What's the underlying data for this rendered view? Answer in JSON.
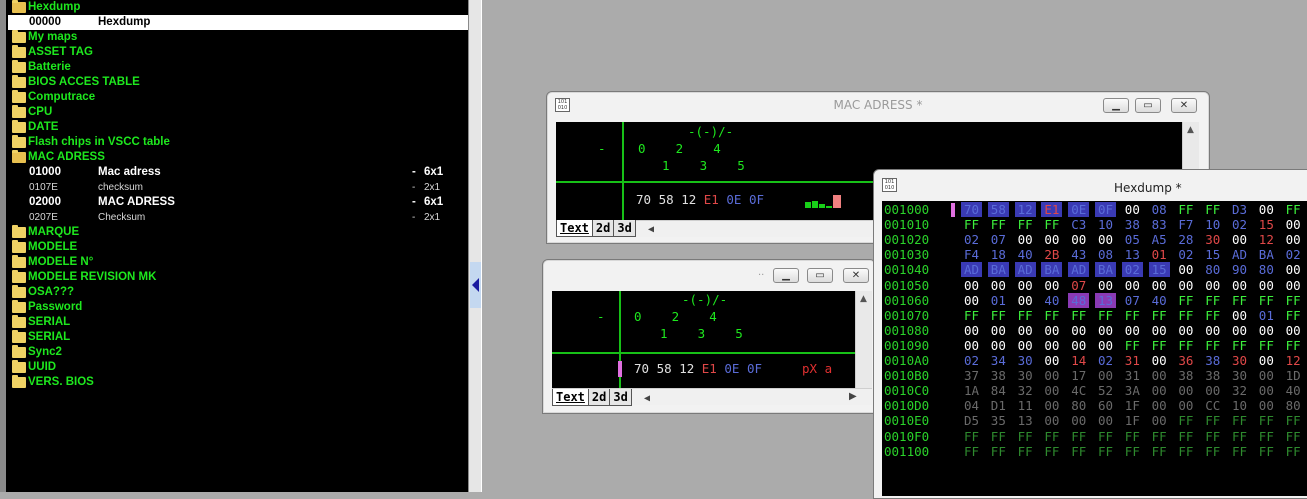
{
  "tree": {
    "items": [
      {
        "kind": "folder",
        "open": true,
        "label": "Hexdump"
      },
      {
        "kind": "leaf",
        "style": "sel",
        "id": "00000",
        "name": "Hexdump"
      },
      {
        "kind": "folder",
        "label": "My maps"
      },
      {
        "kind": "folder",
        "label": "ASSET TAG"
      },
      {
        "kind": "folder",
        "label": "Batterie"
      },
      {
        "kind": "folder",
        "label": "BIOS ACCES TABLE"
      },
      {
        "kind": "folder",
        "label": "Computrace"
      },
      {
        "kind": "folder",
        "label": "CPU"
      },
      {
        "kind": "folder",
        "label": "DATE"
      },
      {
        "kind": "folder",
        "label": "Flash chips in VSCC table"
      },
      {
        "kind": "folder",
        "open": true,
        "label": "MAC ADRESS"
      },
      {
        "kind": "leaf",
        "style": "bold",
        "id": "01000",
        "name": "Mac adress",
        "dash": "-",
        "size": "6x1"
      },
      {
        "kind": "leaf",
        "style": "dim",
        "id": "0107E",
        "name": "checksum",
        "dash": "-",
        "size": "2x1"
      },
      {
        "kind": "leaf",
        "style": "bold",
        "id": "02000",
        "name": "MAC ADRESS",
        "dash": "-",
        "size": "6x1"
      },
      {
        "kind": "leaf",
        "style": "dim",
        "id": "0207E",
        "name": "Checksum",
        "dash": "-",
        "size": "2x1"
      },
      {
        "kind": "folder",
        "label": "MARQUE"
      },
      {
        "kind": "folder",
        "label": "MODELE"
      },
      {
        "kind": "folder",
        "label": "MODELE N°"
      },
      {
        "kind": "folder",
        "label": "MODELE REVISION MK"
      },
      {
        "kind": "folder",
        "label": "OSA???"
      },
      {
        "kind": "folder",
        "label": "Password"
      },
      {
        "kind": "folder",
        "label": "SERIAL"
      },
      {
        "kind": "folder",
        "label": "SERIAL"
      },
      {
        "kind": "folder",
        "label": "Sync2"
      },
      {
        "kind": "folder",
        "label": "UUID"
      },
      {
        "kind": "folder",
        "label": "VERS. BIOS"
      }
    ]
  },
  "mac_window": {
    "title": "MAC ADRESS *",
    "header_line": "-(-)/-",
    "row_marker": "-",
    "top_index": "0    2    4",
    "bottom_index": "1    3    5",
    "bytes": [
      "70",
      "58",
      "12",
      "E1",
      "0E",
      "0F"
    ],
    "tabs": [
      "Text",
      "2d",
      "3d"
    ]
  },
  "checksum_window": {
    "title": "..",
    "header_line": "-(-)/-",
    "row_marker": "-",
    "top_index": "0    2    4",
    "bottom_index": "1    3    5",
    "bytes": [
      "70",
      "58",
      "12",
      "E1",
      "0E",
      "0F"
    ],
    "text_view": "pX a",
    "tabs": [
      "Text",
      "2d",
      "3d"
    ]
  },
  "hex_window": {
    "title": "Hexdump *",
    "rows": [
      {
        "addr": "001000",
        "bytes": [
          "70",
          "58",
          "12",
          "E1",
          "0E",
          "0F",
          "00",
          "08",
          "FF",
          "FF",
          "D3",
          "00",
          "FF"
        ]
      },
      {
        "addr": "001010",
        "bytes": [
          "FF",
          "FF",
          "FF",
          "FF",
          "C3",
          "10",
          "38",
          "83",
          "F7",
          "10",
          "02",
          "15",
          "00"
        ]
      },
      {
        "addr": "001020",
        "bytes": [
          "02",
          "07",
          "00",
          "00",
          "00",
          "00",
          "05",
          "A5",
          "28",
          "30",
          "00",
          "12",
          "00"
        ]
      },
      {
        "addr": "001030",
        "bytes": [
          "F4",
          "18",
          "40",
          "2B",
          "43",
          "08",
          "13",
          "01",
          "02",
          "15",
          "AD",
          "BA",
          "02"
        ]
      },
      {
        "addr": "001040",
        "bytes": [
          "AD",
          "BA",
          "AD",
          "BA",
          "AD",
          "BA",
          "02",
          "15",
          "00",
          "80",
          "90",
          "80",
          "00"
        ]
      },
      {
        "addr": "001050",
        "bytes": [
          "00",
          "00",
          "00",
          "00",
          "07",
          "00",
          "00",
          "00",
          "00",
          "00",
          "00",
          "00",
          "00"
        ]
      },
      {
        "addr": "001060",
        "bytes": [
          "00",
          "01",
          "00",
          "40",
          "48",
          "13",
          "07",
          "40",
          "FF",
          "FF",
          "FF",
          "FF",
          "FF"
        ]
      },
      {
        "addr": "001070",
        "bytes": [
          "FF",
          "FF",
          "FF",
          "FF",
          "FF",
          "FF",
          "FF",
          "FF",
          "FF",
          "FF",
          "00",
          "01",
          "FF"
        ]
      },
      {
        "addr": "001080",
        "bytes": [
          "00",
          "00",
          "00",
          "00",
          "00",
          "00",
          "00",
          "00",
          "00",
          "00",
          "00",
          "00",
          "00"
        ]
      },
      {
        "addr": "001090",
        "bytes": [
          "00",
          "00",
          "00",
          "00",
          "00",
          "00",
          "FF",
          "FF",
          "FF",
          "FF",
          "FF",
          "FF",
          "FF"
        ]
      },
      {
        "addr": "0010A0",
        "bytes": [
          "02",
          "34",
          "30",
          "00",
          "14",
          "02",
          "31",
          "00",
          "36",
          "38",
          "30",
          "00",
          "12"
        ]
      },
      {
        "addr": "0010B0",
        "bytes": [
          "37",
          "38",
          "30",
          "00",
          "17",
          "00",
          "31",
          "00",
          "38",
          "38",
          "30",
          "00",
          "1D"
        ]
      },
      {
        "addr": "0010C0",
        "bytes": [
          "1A",
          "84",
          "32",
          "00",
          "4C",
          "52",
          "3A",
          "00",
          "00",
          "00",
          "32",
          "00",
          "40"
        ]
      },
      {
        "addr": "0010D0",
        "bytes": [
          "04",
          "D1",
          "11",
          "00",
          "80",
          "60",
          "1F",
          "00",
          "00",
          "CC",
          "10",
          "00",
          "80"
        ]
      },
      {
        "addr": "0010E0",
        "bytes": [
          "D5",
          "35",
          "13",
          "00",
          "00",
          "00",
          "1F",
          "00",
          "FF",
          "FF",
          "FF",
          "FF",
          "FF"
        ]
      },
      {
        "addr": "0010F0",
        "bytes": [
          "FF",
          "FF",
          "FF",
          "FF",
          "FF",
          "FF",
          "FF",
          "FF",
          "FF",
          "FF",
          "FF",
          "FF",
          "FF"
        ]
      },
      {
        "addr": "001100",
        "bytes": [
          "FF",
          "FF",
          "FF",
          "FF",
          "FF",
          "FF",
          "FF",
          "FF",
          "FF",
          "FF",
          "FF",
          "FF",
          "FF"
        ]
      }
    ]
  },
  "colors": {
    "tree_folder": "#1ee81e",
    "address": "#2ad22a",
    "hex_ff": "#3cf03c",
    "hex_00": "#ffffff",
    "hex_other": "#5a6cd8",
    "hex_red": "#e04848",
    "hex_dim": "#6a6a6a",
    "selection_bg": "#3a3ab4"
  }
}
